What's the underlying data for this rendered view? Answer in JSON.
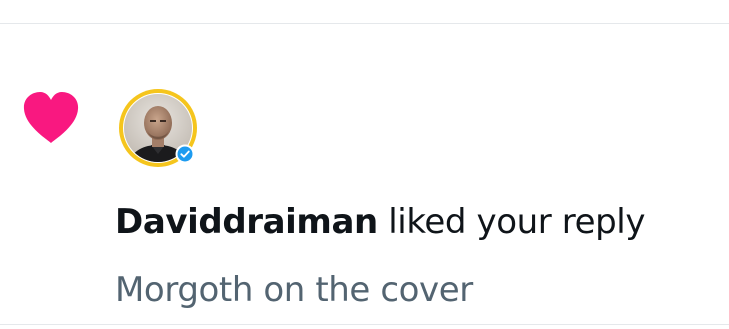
{
  "notification": {
    "type_icon": "heart-icon",
    "type_icon_color": "#f91880",
    "avatar_ring_color": "#f5c51d",
    "avatar_badge_icon": "verified-badge-icon",
    "avatar_badge_color": "#1d9bf0",
    "username": "Daviddraiman",
    "action_text": "liked your reply",
    "reply_preview": "Morgoth on the cover"
  }
}
